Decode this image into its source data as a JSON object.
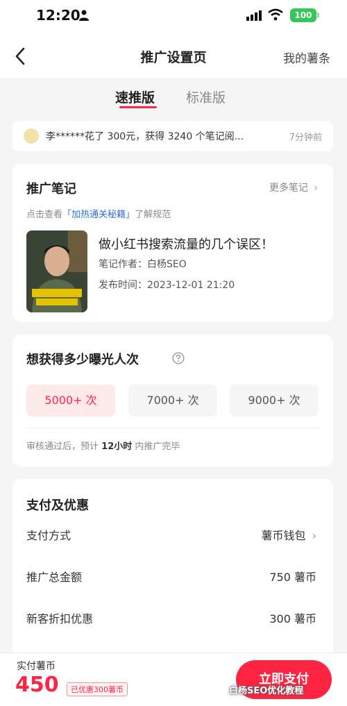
{
  "status_bar": {
    "time": "12:20",
    "battery": "100"
  },
  "nav": {
    "title": "推广设置页",
    "right_label": "我的薯条"
  },
  "tabs": [
    {
      "label": "速推版",
      "active": true
    },
    {
      "label": "标准版",
      "active": false
    }
  ],
  "notice": {
    "text": "李******花了 300元，获得 3240 个笔记阅...",
    "time": "7分钟前"
  },
  "promo_note": {
    "section_title": "推广笔记",
    "more_label": "更多笔记",
    "rule_prefix": "点击查看",
    "rule_link": "「加热通关秘籍」",
    "rule_suffix": "了解规范",
    "note_title": "做小红书搜索流量的几个误区！",
    "author_label": "笔记作者：",
    "author": "白杨SEO",
    "publish_label": "发布时间：",
    "publish_time": "2023-12-01 21:20"
  },
  "exposure": {
    "title": "想获得多少曝光人次",
    "options": [
      "5000+ 次",
      "7000+ 次",
      "9000+ 次"
    ],
    "selected_index": 0,
    "review_prefix": "审核通过后，预计",
    "review_time": "12小时",
    "review_suffix": "内推广完毕"
  },
  "payment": {
    "title": "支付及优惠",
    "method_label": "支付方式",
    "method_value": "薯币钱包",
    "total_label": "推广总金额",
    "total_value": "750 薯币",
    "discount_label": "新客折扣优惠",
    "discount_value": "300 薯币"
  },
  "bottom": {
    "pay_label": "实付薯币",
    "amount": "450",
    "discount_badge": "已优惠300薯币",
    "pay_button": "立即支付"
  },
  "watermark": "白杨SEO优化教程",
  "colors": {
    "accent": "#ff2442",
    "battery": "#34c759",
    "link": "#2f6fd0"
  },
  "icons": [
    "person-icon",
    "signal-icon",
    "wifi-icon",
    "back-icon",
    "chevron-right-icon",
    "help-icon"
  ]
}
